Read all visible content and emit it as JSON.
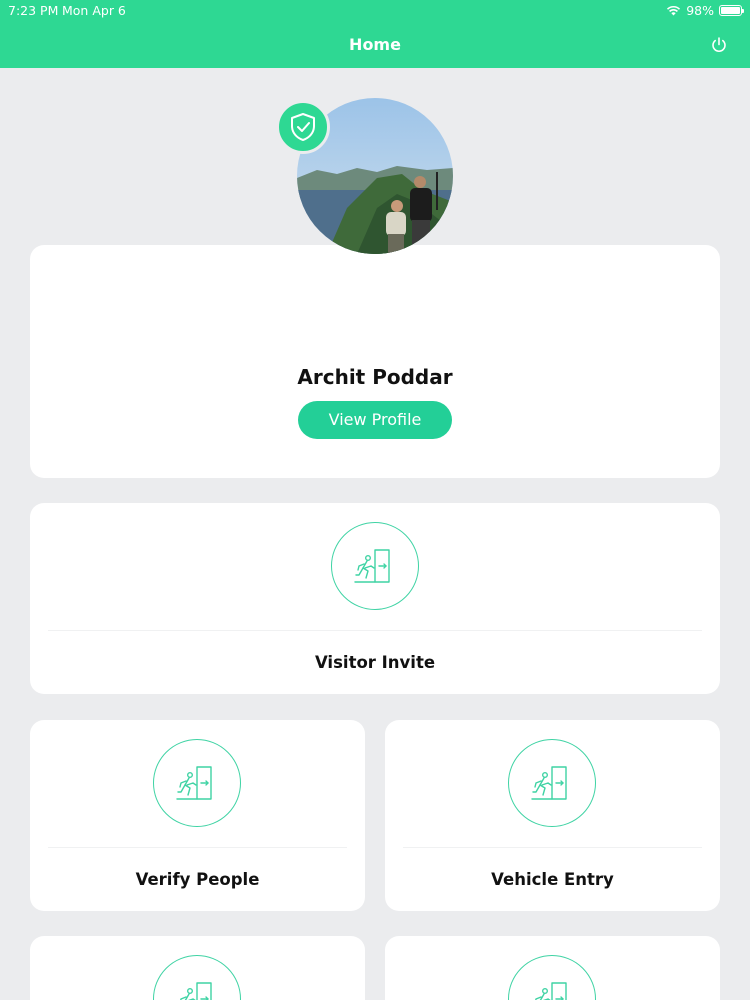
{
  "status_bar": {
    "time": "7:23 PM",
    "date": "Mon Apr 6",
    "battery": "98%",
    "battery_level": 0.98
  },
  "header": {
    "title": "Home"
  },
  "profile": {
    "name": "Archit Poddar",
    "view_profile_label": "View Profile"
  },
  "tiles": [
    {
      "label": "Visitor Invite",
      "icon": "door-exit-icon"
    },
    {
      "label": "Verify People",
      "icon": "door-exit-icon"
    },
    {
      "label": "Vehicle Entry",
      "icon": "door-exit-icon"
    }
  ],
  "colors": {
    "accent": "#2ed893",
    "button": "#23cf97",
    "background": "#ebecee"
  }
}
